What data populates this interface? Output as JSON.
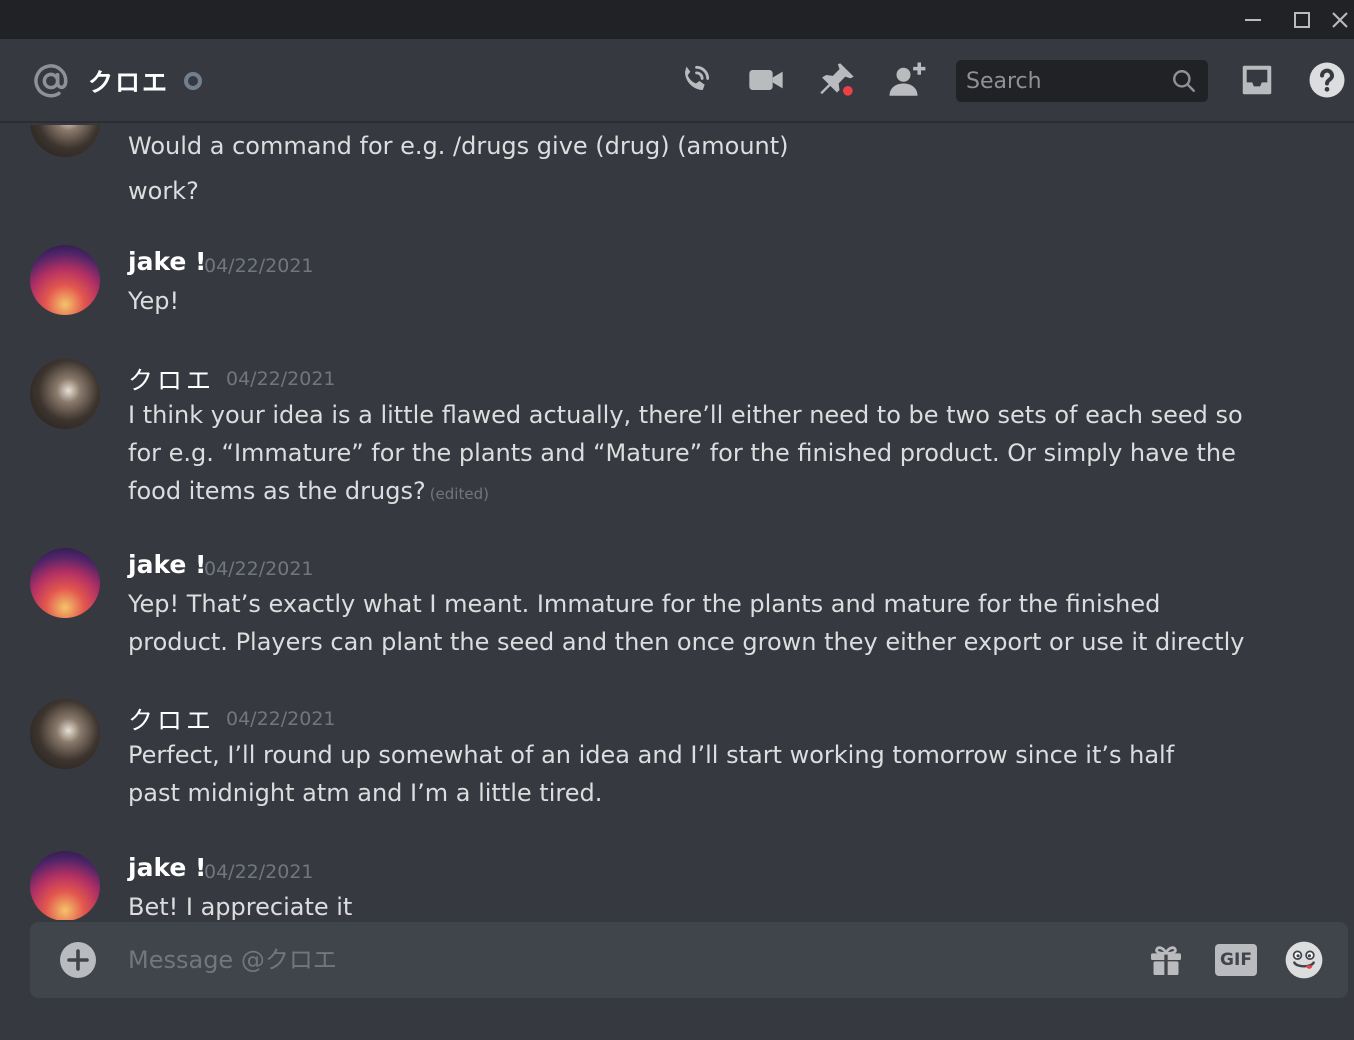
{
  "window": {
    "minimize_icon": "minimize-icon",
    "maximize_icon": "maximize-icon",
    "close_icon": "close-icon"
  },
  "header": {
    "channel_icon": "at-sign-icon",
    "dm_name": "クロエ",
    "status": "offline",
    "icons": [
      "start-voice-call-icon",
      "start-video-call-icon",
      "pinned-messages-icon",
      "add-friends-to-dm-icon",
      "inbox-icon",
      "help-icon"
    ],
    "search_placeholder": "Search"
  },
  "messages": [
    {
      "continuation": true,
      "avatar": "kuroe-avatar",
      "text": "Would a command for e.g. /drugs give  (drug) (amount) work?"
    },
    {
      "author": "jake !",
      "timestamp": "04/22/2021",
      "avatar": "jake-avatar",
      "text": "Yep!"
    },
    {
      "author": "クロエ",
      "timestamp": "04/22/2021",
      "avatar": "kuroe-avatar",
      "text": "I think your idea is a little flawed actually, there’ll either need to be two sets of each seed so for e.g. “Immature” for the plants and “Mature” for the finished product. Or simply have the food items as the drugs?",
      "edited": "(edited)"
    },
    {
      "author": "jake !",
      "timestamp": "04/22/2021",
      "avatar": "jake-avatar",
      "text": "Yep! That’s exactly what I meant. Immature for the plants and mature for the finished product. Players can plant the seed and then once grown they either export or use it directly"
    },
    {
      "author": "クロエ",
      "timestamp": "04/22/2021",
      "avatar": "kuroe-avatar",
      "text": "Perfect, I’ll round up somewhat of an idea and I’ll start working tomorrow since it’s half past midnight atm and I’m a little tired."
    },
    {
      "author": "jake !",
      "timestamp": "04/22/2021",
      "avatar": "jake-avatar",
      "text": "Bet! I appreciate it"
    }
  ],
  "composer": {
    "placeholder": "Message @クロエ",
    "gif_label": "GIF",
    "icons": [
      "add-attachment-icon",
      "gift-icon",
      "gif-icon",
      "emoji-icon"
    ]
  },
  "colors": {
    "background": "#36393f",
    "titlebar": "#202225",
    "composer": "#40444b",
    "text": "#dcddde",
    "muted": "#72767d",
    "notification": "#ed4245"
  }
}
